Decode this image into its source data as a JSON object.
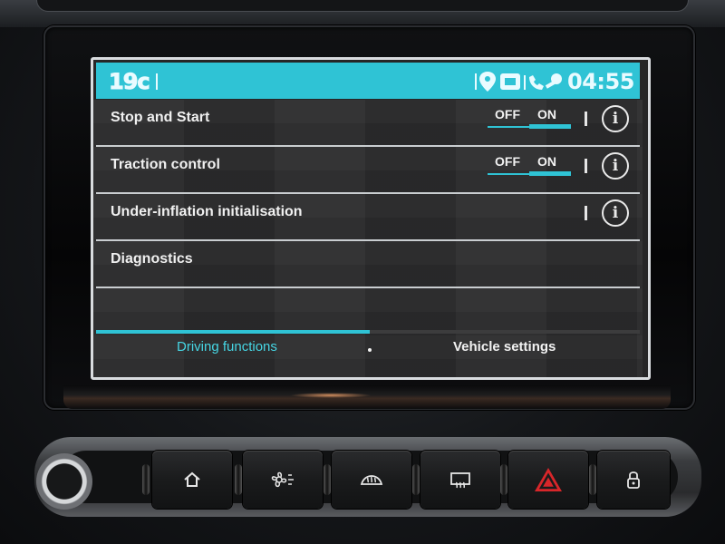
{
  "status_bar": {
    "temperature": "19c",
    "clock": "04:55",
    "icons": [
      "location-icon",
      "media-icon",
      "phone-icon",
      "key-icon"
    ]
  },
  "settings": [
    {
      "label": "Stop and Start",
      "toggle": {
        "off": "OFF",
        "on": "ON",
        "state": "ON"
      },
      "info": "i"
    },
    {
      "label": "Traction control",
      "toggle": {
        "off": "OFF",
        "on": "ON",
        "state": "ON"
      },
      "info": "i"
    },
    {
      "label": "Under-inflation initialisation",
      "info": "i"
    },
    {
      "label": "Diagnostics"
    }
  ],
  "tabs": [
    {
      "label": "Driving functions",
      "active": true
    },
    {
      "label": "Vehicle settings",
      "active": false
    }
  ],
  "accent_color": "#2fc3d5",
  "hardware_buttons": [
    "volume-knob",
    "home-icon",
    "fan-icon",
    "front-defrost-icon",
    "rear-defrost-icon",
    "hazard-icon",
    "lock-icon"
  ]
}
